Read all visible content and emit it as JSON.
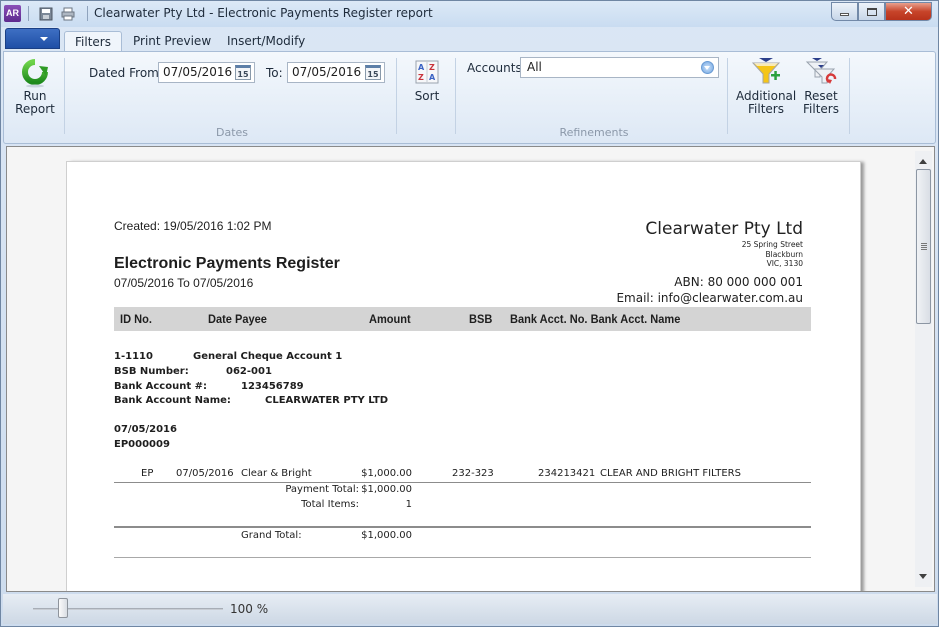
{
  "window": {
    "app_icon_label": "AR",
    "title": "Clearwater Pty Ltd - Electronic Payments Register report",
    "controls": {
      "minimize": "minimize",
      "maximize": "maximize",
      "close": "close"
    }
  },
  "quick_access": [
    {
      "icon": "save-icon"
    },
    {
      "icon": "print-icon"
    }
  ],
  "ribbon": {
    "tabs": [
      {
        "label": "Filters",
        "active": true
      },
      {
        "label": "Print Preview",
        "active": false
      },
      {
        "label": "Insert/Modify",
        "active": false
      }
    ],
    "run_report": {
      "line1": "Run",
      "line2": "Report"
    },
    "dates": {
      "group_label": "Dates",
      "from_label": "Dated From:",
      "from_value": "07/05/2016",
      "to_label": "To:",
      "to_value": "07/05/2016",
      "calendar_day": "15"
    },
    "sort": {
      "label": "Sort"
    },
    "refinements": {
      "group_label": "Refinements",
      "accounts_label": "Accounts:",
      "accounts_value": "All"
    },
    "additional_filters": {
      "line1": "Additional",
      "line2": "Filters"
    },
    "reset_filters": {
      "line1": "Reset",
      "line2": "Filters"
    }
  },
  "report": {
    "created": "Created: 19/05/2016 1:02 PM",
    "title": "Electronic Payments Register",
    "date_range": "07/05/2016 To 07/05/2016",
    "company": {
      "name": "Clearwater Pty Ltd",
      "address1": "25 Spring Street",
      "address2": "Blackburn",
      "address3": "VIC, 3130",
      "abn": "ABN: 80 000 000 001",
      "email": "Email: info@clearwater.com.au"
    },
    "columns": [
      "ID No.",
      "Date Payee",
      "Amount",
      "BSB",
      "Bank Acct. No. Bank Acct. Name"
    ],
    "account": {
      "id": "1-1110",
      "name": "General Cheque Account 1",
      "bsb_label": "BSB Number:",
      "bsb": "062-001",
      "acct_no_label": "Bank Account #:",
      "acct_no": "123456789",
      "acct_name_label": "Bank Account Name:",
      "acct_name": "CLEARWATER PTY LTD"
    },
    "payment_group": {
      "date": "07/05/2016",
      "ref": "EP000009"
    },
    "rows": [
      {
        "id": "EP",
        "date": "07/05/2016",
        "payee": "Clear & Bright",
        "amount": "$1,000.00",
        "bsb": "232-323",
        "acct_no": "234213421",
        "acct_name": "CLEAR AND BRIGHT FILTERS"
      }
    ],
    "payment_total_label": "Payment Total:",
    "payment_total": "$1,000.00",
    "total_items_label": "Total Items:",
    "total_items": "1",
    "grand_total_label": "Grand Total:",
    "grand_total": "$1,000.00"
  },
  "statusbar": {
    "zoom_percent": 100,
    "zoom_label": "100 %"
  }
}
